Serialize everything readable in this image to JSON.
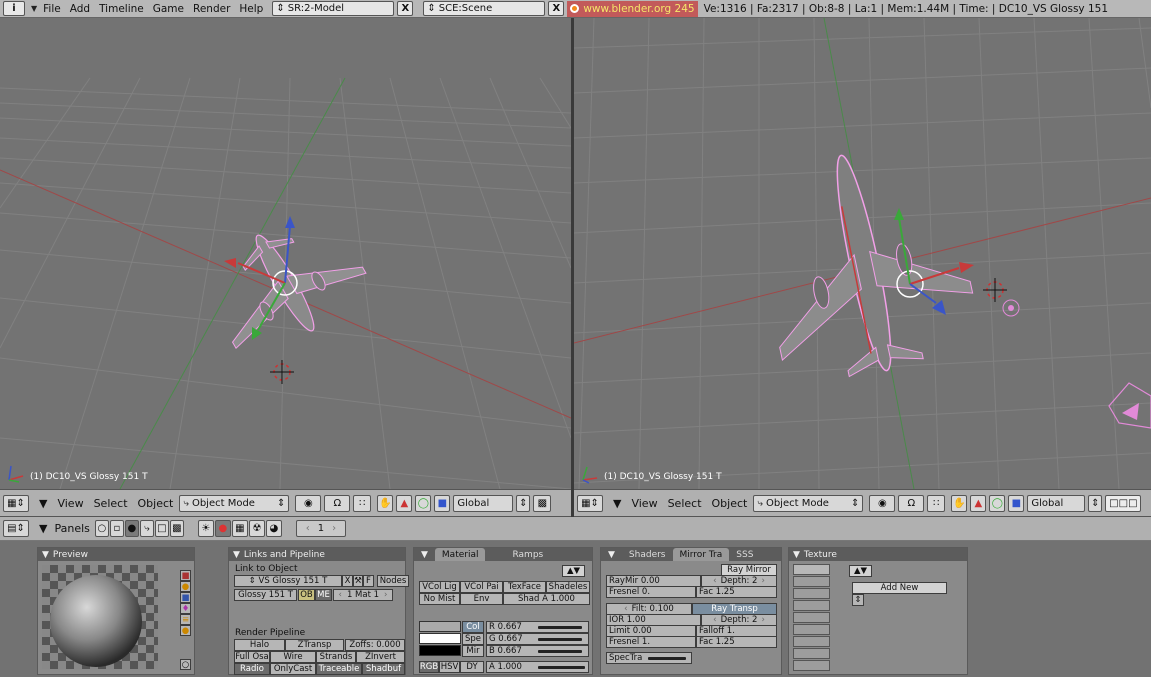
{
  "topbar": {
    "info_icon": "i",
    "menus": [
      "File",
      "Add",
      "Timeline",
      "Game",
      "Render",
      "Help"
    ],
    "screen": "SR:2-Model",
    "scene": "SCE:Scene",
    "url": "www.blender.org 245",
    "stats": "Ve:1316 | Fa:2317 | Ob:8-8 | La:1  | Mem:1.44M  | Time: | DC10_VS Glossy 151"
  },
  "viewports": {
    "left_label": "(1) DC10_VS Glossy 151 T",
    "right_label": "(1) DC10_VS Glossy 151 T"
  },
  "view_header": {
    "menus": [
      "View",
      "Select",
      "Object"
    ],
    "mode": "Object Mode",
    "orientation": "Global"
  },
  "buttons_header": {
    "panels_label": "Panels",
    "frame": "1"
  },
  "preview": {
    "title": "Preview"
  },
  "links": {
    "title": "Links and Pipeline",
    "link_to_object": "Link to Object",
    "ob_name": "VS Glossy 151 T",
    "x": "X",
    "f": "F",
    "nodes": "Nodes",
    "material_name": "Glossy 151 T",
    "ob": "OB",
    "me": "ME",
    "mat_count": "1 Mat 1",
    "render_pipeline": "Render Pipeline",
    "halo": "Halo",
    "ztransp": "ZTransp",
    "zoffs": "Zoffs: 0.000",
    "full_osa": "Full Osa",
    "wire": "Wire",
    "strands": "Strands",
    "zinvert": "ZInvert",
    "radio": "Radio",
    "onlycast": "OnlyCast",
    "traceable": "Traceable",
    "shadbuf": "Shadbuf"
  },
  "material": {
    "tab1": "Material",
    "tab2": "Ramps",
    "vcol_light": "VCol Lig",
    "vcol_paint": "VCol Pai",
    "texface": "TexFace",
    "shadeless": "Shadeles",
    "no_mist": "No Mist",
    "env": "Env",
    "shad_a": "Shad A 1.000",
    "col": "Col",
    "spe": "Spe",
    "mir": "Mir",
    "r": "R 0.667",
    "g": "G 0.667",
    "b": "B 0.667",
    "rgb": "RGB",
    "hsv": "HSV",
    "dyn": "DY",
    "alpha": "A 1.000"
  },
  "mirror": {
    "tab1": "Shaders",
    "tab2": "Mirror Tra",
    "tab3": "SSS",
    "ray_mirror": "Ray Mirror",
    "raymir": "RayMir 0.00",
    "depth1": "Depth: 2",
    "fresnel1": "Fresnel 0.",
    "fac1": "Fac 1.25",
    "filt": "Filt: 0.100",
    "ray_transp": "Ray Transp",
    "ior": "IOR 1.00",
    "depth2": "Depth: 2",
    "limit": "Limit 0.00",
    "falloff": "Falloff 1.",
    "fresnel2": "Fresnel 1.",
    "fac2": "Fac 1.25",
    "spectra": "SpecTra"
  },
  "texture": {
    "title": "Texture",
    "add_new": "Add New"
  },
  "colors": {
    "grid_bg": "#737373",
    "grid_line": "#808080",
    "x_axis": "#b03030",
    "y_axis": "#3f9a3f",
    "selected_outline": "#f2a0e8",
    "url_bg": "#c25a5a"
  }
}
